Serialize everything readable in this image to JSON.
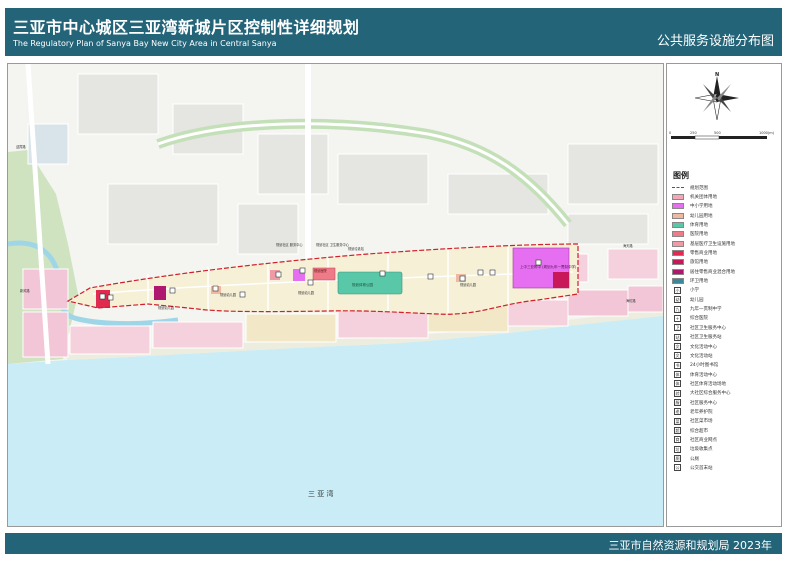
{
  "header": {
    "title_cn": "三亚市中心城区三亚湾新城片区控制性详细规划",
    "title_en": "The Regulatory Plan of Sanya Bay New City Area in Central Sanya",
    "map_name": "公共服务设施分布图"
  },
  "compass": {
    "north": "N"
  },
  "scale_bar": {
    "ticks": [
      "0",
      "250",
      "500",
      "1000(m)"
    ]
  },
  "legend": {
    "title": "图例",
    "items": [
      {
        "label": "规划范围",
        "kind": "dash",
        "color": "#d0202a"
      },
      {
        "label": "机关团体用地",
        "kind": "swatch",
        "color": "#f6a6b6",
        "code": "0801"
      },
      {
        "label": "中小学用地",
        "kind": "swatch",
        "color": "#e66ef0",
        "code": "080403"
      },
      {
        "label": "幼儿园用地",
        "kind": "swatch",
        "color": "#f0b8a0",
        "code": "080404"
      },
      {
        "label": "体育用地",
        "kind": "swatch",
        "color": "#59c8a8",
        "code": "0805"
      },
      {
        "label": "医院用地",
        "kind": "swatch",
        "color": "#ef7a88",
        "code": "080601"
      },
      {
        "label": "基层医疗卫生设施用地",
        "kind": "swatch",
        "color": "#ef9aa6",
        "code": "080602"
      },
      {
        "label": "零售商业用地",
        "kind": "swatch",
        "color": "#e02a50",
        "code": "090101"
      },
      {
        "label": "旅馆用地",
        "kind": "swatch",
        "color": "#c8185a",
        "code": "090104"
      },
      {
        "label": "居住零售商业混合用地",
        "kind": "swatch",
        "color": "#b01870",
        "code": "0701/0901"
      },
      {
        "label": "环卫用地",
        "kind": "swatch",
        "color": "#3a8898",
        "code": "1309"
      },
      {
        "label": "小学",
        "kind": "icon",
        "glyph": "小"
      },
      {
        "label": "幼儿园",
        "kind": "icon",
        "glyph": "幼"
      },
      {
        "label": "九年一贯制中学",
        "kind": "icon",
        "glyph": "九"
      },
      {
        "label": "综合医院",
        "kind": "icon",
        "glyph": "+"
      },
      {
        "label": "社区卫生服务中心",
        "kind": "icon",
        "glyph": "卫"
      },
      {
        "label": "社区卫生服务站",
        "kind": "icon",
        "glyph": "站"
      },
      {
        "label": "文化活动中心",
        "kind": "icon",
        "glyph": "文"
      },
      {
        "label": "文化活动站",
        "kind": "icon",
        "glyph": "文"
      },
      {
        "label": "24小时图书馆",
        "kind": "icon",
        "glyph": "书"
      },
      {
        "label": "体育活动中心",
        "kind": "icon",
        "glyph": "体"
      },
      {
        "label": "社区体育活动场地",
        "kind": "icon",
        "glyph": "体"
      },
      {
        "label": "大社区综合服务中心",
        "kind": "icon",
        "glyph": "综"
      },
      {
        "label": "社区服务中心",
        "kind": "icon",
        "glyph": "服"
      },
      {
        "label": "老年养护院",
        "kind": "icon",
        "glyph": "老"
      },
      {
        "label": "社区菜市场",
        "kind": "icon",
        "glyph": "菜"
      },
      {
        "label": "综合超市",
        "kind": "icon",
        "glyph": "超"
      },
      {
        "label": "社区商业网点",
        "kind": "icon",
        "glyph": "商"
      },
      {
        "label": "垃圾收集点",
        "kind": "icon",
        "glyph": "垃"
      },
      {
        "label": "公厕",
        "kind": "icon",
        "glyph": "厕"
      },
      {
        "label": "公交首末站",
        "kind": "icon",
        "glyph": "公"
      }
    ]
  },
  "map": {
    "sea_label": "三  亚  湾",
    "labels": {
      "elementary_school": "上中三亚附中\n(规划九年一贯制中学)",
      "sports_park": "规划体育公园",
      "hospital": "规划医院",
      "health_center": "规划社区\n卫生服务中心",
      "community_service": "规划社区\n服务中心",
      "kindergarten_a": "规划幼儿园",
      "kindergarten_b": "规划幼儿园",
      "kindergarten_c": "规划幼儿园",
      "kindergarten_d": "规划幼儿园",
      "garbage": "规划垃圾站",
      "road_east_a": "海天路",
      "road_east_b": "海虹路",
      "road_west": "新风路",
      "road_north": "迎宾路"
    }
  },
  "footer": {
    "org_year": "三亚市自然资源和规划局  2023年"
  }
}
